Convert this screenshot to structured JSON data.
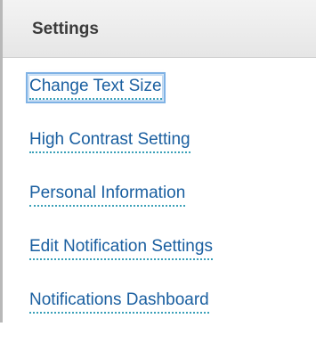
{
  "header": {
    "title": "Settings"
  },
  "menu": {
    "items": [
      {
        "label": "Change Text Size"
      },
      {
        "label": "High Contrast Setting"
      },
      {
        "label": "Personal Information"
      },
      {
        "label": "Edit Notification Settings"
      },
      {
        "label": "Notifications Dashboard"
      }
    ]
  },
  "colors": {
    "link": "#1a5fa0",
    "link_underline": "#3aa0b8",
    "focus_ring": "#7fb2e5",
    "header_bg": "#e6e6e6",
    "header_text": "#3a3a3a"
  }
}
